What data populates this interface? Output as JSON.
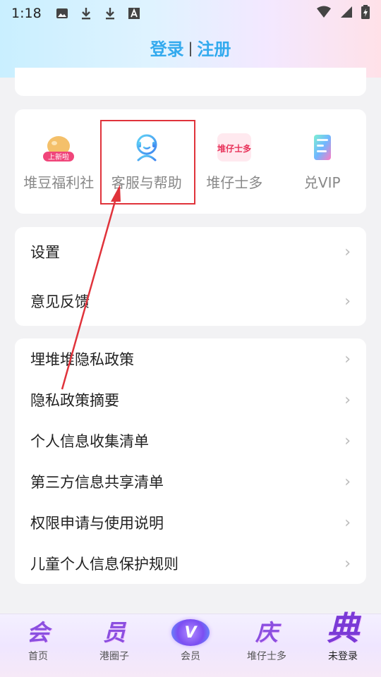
{
  "status_bar": {
    "time": "1:18",
    "icons": [
      "image-icon",
      "download-icon",
      "download-icon",
      "a-icon"
    ],
    "right_icons": [
      "wifi-icon",
      "signal-icon",
      "battery-icon"
    ]
  },
  "header": {
    "login": "登录",
    "separator": "|",
    "register": "注册"
  },
  "grid": {
    "items": [
      {
        "label": "堆豆福利社",
        "icon": "bean-gift-icon",
        "badge": "上新啦"
      },
      {
        "label": "客服与帮助",
        "icon": "customer-service-icon"
      },
      {
        "label": "堆仔士多",
        "icon": "store-logo-icon",
        "logo_text": "堆仔士多"
      },
      {
        "label": "兑VIP",
        "icon": "vip-card-icon"
      }
    ]
  },
  "menu1": {
    "items": [
      {
        "label": "设置"
      },
      {
        "label": "意见反馈"
      }
    ]
  },
  "menu2": {
    "items": [
      {
        "label": "埋堆堆隐私政策"
      },
      {
        "label": "隐私政策摘要"
      },
      {
        "label": "个人信息收集清单"
      },
      {
        "label": "第三方信息共享清单"
      },
      {
        "label": "权限申请与使用说明"
      },
      {
        "label": "儿童个人信息保护规则"
      }
    ]
  },
  "chevron": "›",
  "bottom_nav": {
    "items": [
      {
        "glyph": "会",
        "label": "首页"
      },
      {
        "glyph": "员",
        "label": "港圈子"
      },
      {
        "glyph": "V",
        "label": "会员"
      },
      {
        "glyph": "庆",
        "label": "堆仔士多"
      },
      {
        "glyph": "典",
        "label": "未登录"
      }
    ]
  },
  "colors": {
    "accent": "#33aaee",
    "highlight": "#e0333b",
    "nav_purple": "#8b4fe0"
  }
}
